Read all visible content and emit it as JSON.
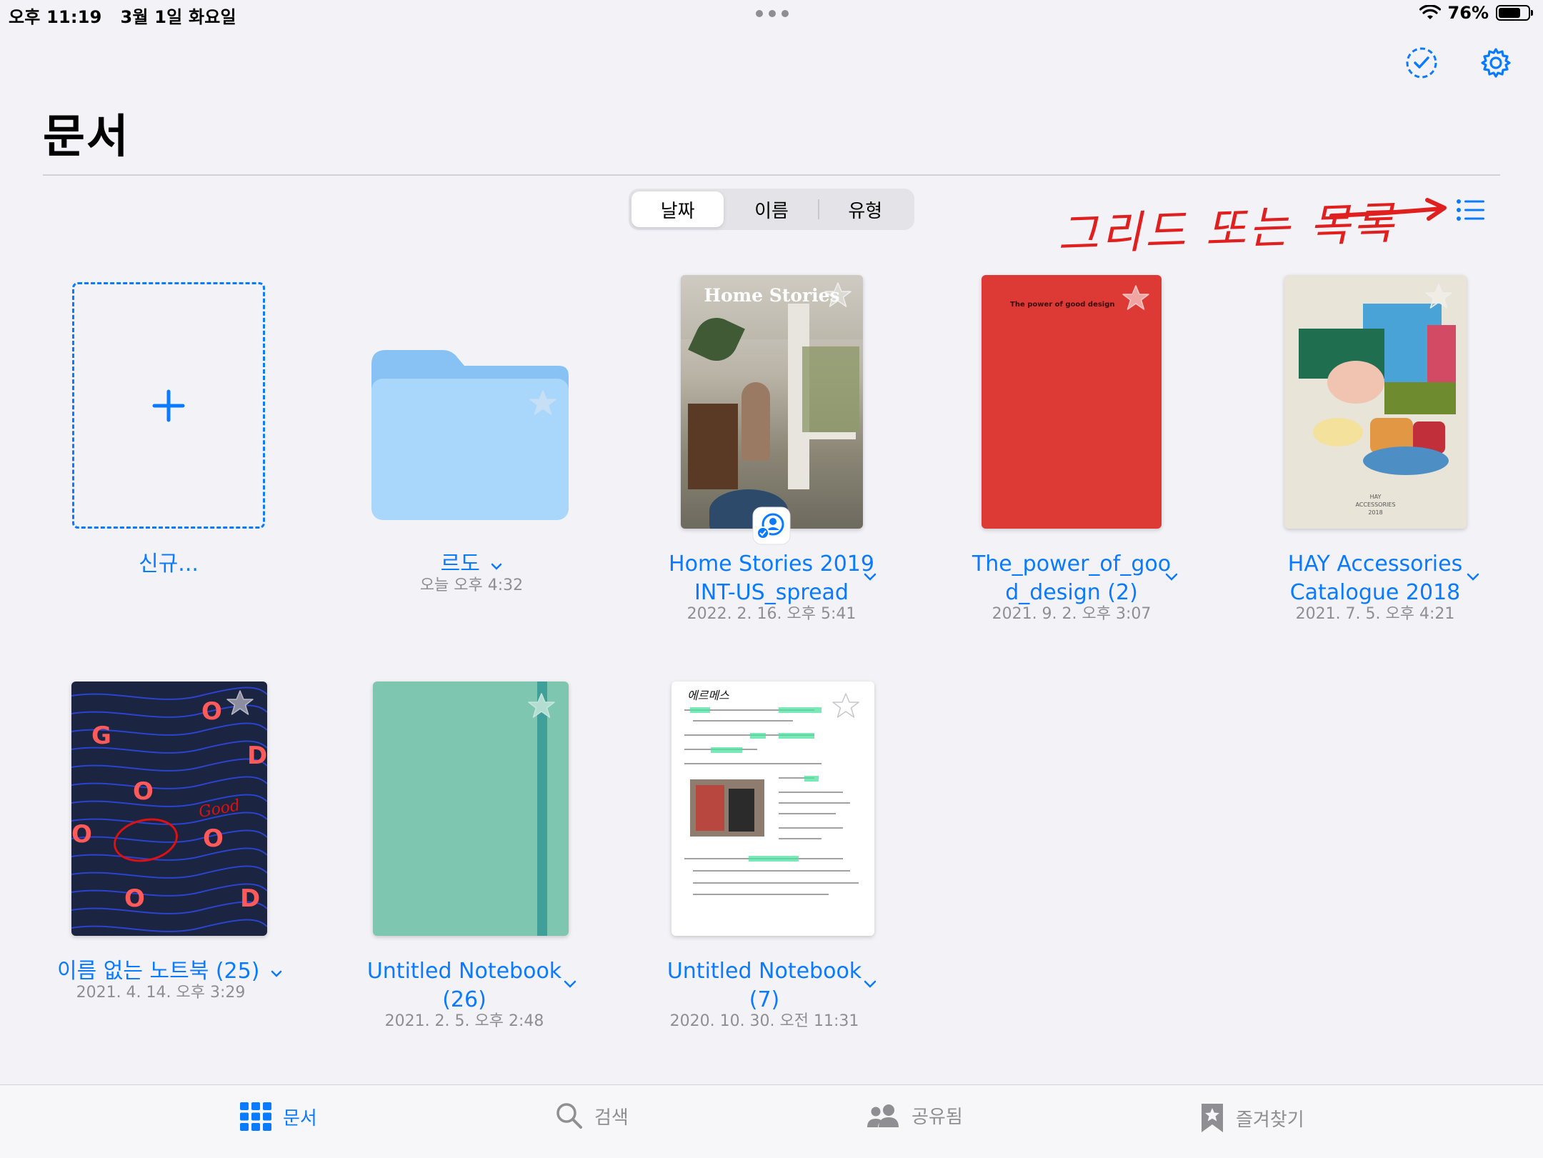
{
  "status_bar": {
    "time": "오후 11:19",
    "date": "3월 1일 화요일",
    "battery": "76%",
    "battery_level": 0.76
  },
  "header": {
    "title": "문서",
    "select_icon": "dashed-checkmark-circle-icon",
    "settings_icon": "gear-icon"
  },
  "sort": {
    "options": [
      "날짜",
      "이름",
      "유형"
    ],
    "selected": "날짜"
  },
  "annotation": {
    "text": "그리드 또는 목록",
    "color": "#e0201f"
  },
  "view_toggle_icon": "list-icon",
  "items": [
    {
      "name": "신규..."
    },
    {
      "name": "르도",
      "date": "오늘 오후 4:32"
    },
    {
      "name_line1": "Home Stories 2019",
      "name_line2": "INT-US_spread",
      "date": "2022. 2. 16. 오후 5:41",
      "cover_title": "Home Stories",
      "badge_icon": "shared-person-icon"
    },
    {
      "name_line1": "The_power_of_goo",
      "name_line2": "d_design (2)",
      "date": "2021. 9. 2. 오후 3:07",
      "cover_title": "The power of good design"
    },
    {
      "name_line1": "HAY Accessories",
      "name_line2": "Catalogue  2018",
      "date": "2021. 7. 5. 오후 4:21",
      "cover_title_1": "HAY",
      "cover_title_2": "ACCESSORIES",
      "cover_title_3": "2018"
    },
    {
      "name": "이름 없는 노트북 (25)",
      "date": "2021. 4. 14. 오후 3:29",
      "cover_letters": [
        "G",
        "O",
        "O",
        "D",
        "O",
        "O",
        "O",
        "D"
      ],
      "cover_script": "Good"
    },
    {
      "name_line1": "Untitled Notebook",
      "name_line2": "(26)",
      "date": "2021. 2. 5. 오후 2:48"
    },
    {
      "name_line1": "Untitled Notebook",
      "name_line2": "(7)",
      "date": "2020. 10. 30. 오전 11:31",
      "cover_heading": "에르메스"
    }
  ],
  "tabs": [
    {
      "label": "문서",
      "icon": "grid-icon",
      "active": true
    },
    {
      "label": "검색",
      "icon": "search-icon"
    },
    {
      "label": "공유됨",
      "icon": "people-icon"
    },
    {
      "label": "즐겨찾기",
      "icon": "bookmark-star-icon"
    }
  ],
  "colors": {
    "accent": "#0a7aff",
    "background": "#f2f2f7",
    "red_cover": "#dd3a36",
    "green_cover": "#7fc6b1",
    "navy_cover": "#1b2440"
  }
}
